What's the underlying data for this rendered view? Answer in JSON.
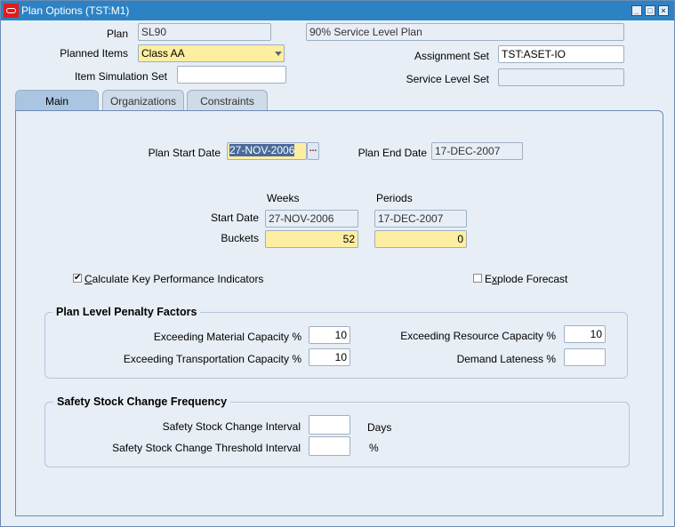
{
  "window": {
    "title": "Plan Options (TST:M1)",
    "controls": [
      "minimize-icon",
      "maximize-icon",
      "close-icon"
    ]
  },
  "header": {
    "plan_label": "Plan",
    "plan_value": "SL90",
    "plan_description": "90% Service Level Plan",
    "planned_items_label": "Planned Items",
    "planned_items_value": "Class AA",
    "item_simulation_set_label": "Item Simulation Set",
    "item_simulation_set_value": "",
    "assignment_set_label": "Assignment Set",
    "assignment_set_value": "TST:ASET-IO",
    "service_level_set_label": "Service Level Set",
    "service_level_set_value": ""
  },
  "tabs": [
    {
      "label": "Main",
      "active": true
    },
    {
      "label": "Organizations",
      "active": false
    },
    {
      "label": "Constraints",
      "active": false
    }
  ],
  "main": {
    "plan_start_date_label": "Plan Start Date",
    "plan_start_date_value": "27-NOV-2006",
    "lov_button_label": "...",
    "plan_end_date_label": "Plan End Date",
    "plan_end_date_value": "17-DEC-2007",
    "weeks_header": "Weeks",
    "periods_header": "Periods",
    "start_date_label": "Start Date",
    "weeks_start_date": "27-NOV-2006",
    "periods_start_date": "17-DEC-2007",
    "buckets_label": "Buckets",
    "weeks_buckets": "52",
    "periods_buckets": "0",
    "calc_kpi_label_accel": "C",
    "calc_kpi_label_rest": "alculate Key Performance Indicators",
    "calc_kpi_checked": true,
    "explode_forecast_label_pre": "E",
    "explode_forecast_label_accel": "x",
    "explode_forecast_label_rest": "plode Forecast",
    "explode_forecast_checked": false
  },
  "penalty": {
    "title": "Plan Level Penalty Factors",
    "material_label": "Exceeding Material Capacity %",
    "material_value": "10",
    "transportation_label": "Exceeding Transportation Capacity %",
    "transportation_value": "10",
    "resource_label": "Exceeding Resource Capacity %",
    "resource_value": "10",
    "lateness_label": "Demand Lateness %",
    "lateness_value": ""
  },
  "safety": {
    "title": "Safety Stock Change Frequency",
    "interval_label": "Safety Stock Change Interval",
    "interval_value": "",
    "interval_unit": "Days",
    "threshold_label": "Safety Stock Change Threshold Interval",
    "threshold_value": "",
    "threshold_unit": "%"
  }
}
